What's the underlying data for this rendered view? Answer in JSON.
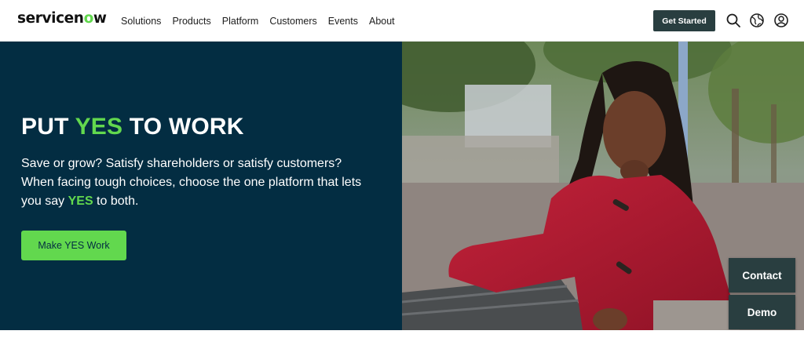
{
  "header": {
    "logo_prefix": "servicen",
    "logo_o": "o",
    "logo_suffix": "w",
    "nav": [
      "Solutions",
      "Products",
      "Platform",
      "Customers",
      "Events",
      "About"
    ],
    "get_started": "Get Started",
    "icons": [
      "search-icon",
      "globe-icon",
      "user-icon"
    ]
  },
  "hero": {
    "title_part1": "PUT ",
    "title_accent": "YES",
    "title_part2": " TO WORK",
    "body_line1": "Save or grow? Satisfy shareholders or satisfy customers?",
    "body_line2": "When facing tough choices, choose the one platform that lets",
    "body_line3_pre": "you say ",
    "body_accent": "YES",
    "body_line3_post": " to both.",
    "cta": "Make YES Work"
  },
  "floating": {
    "contact": "Contact",
    "demo": "Demo"
  },
  "colors": {
    "brand_green": "#62d84e",
    "hero_bg": "#032d42",
    "dark_button": "#293e40"
  }
}
